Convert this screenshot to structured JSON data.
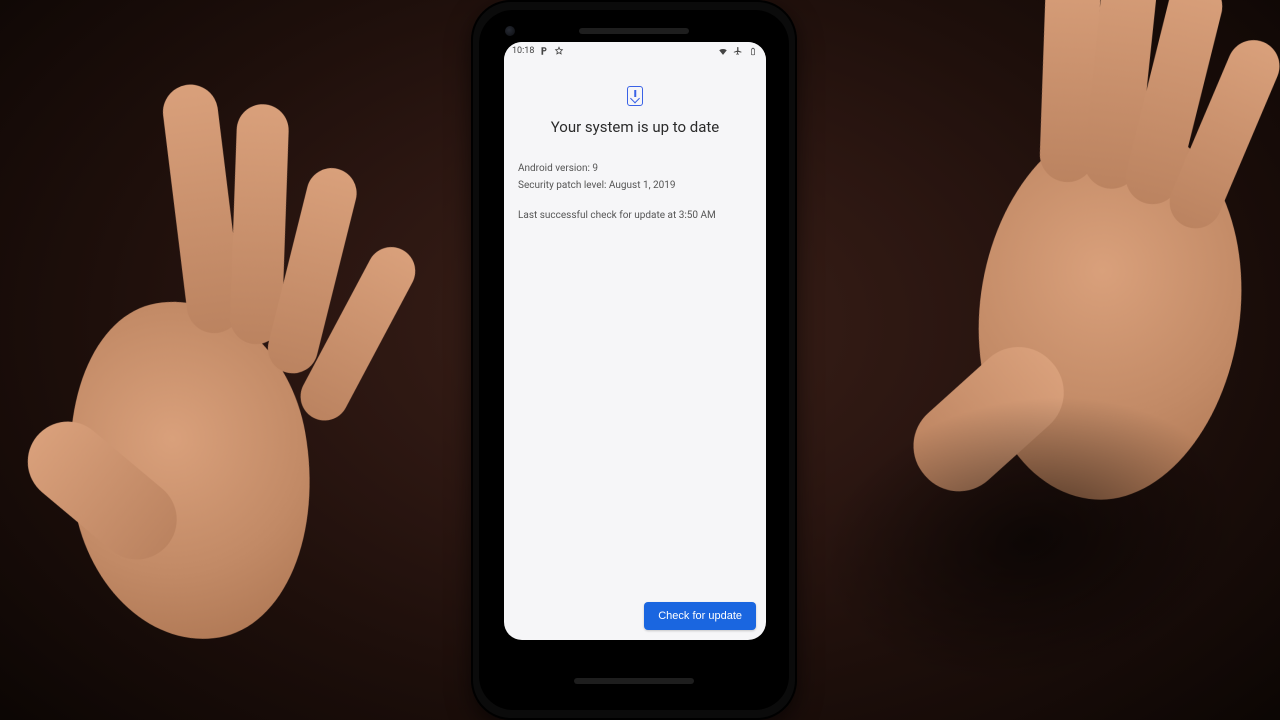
{
  "statusbar": {
    "time": "10:18",
    "left_icons": [
      "parking-icon",
      "star-outline-icon"
    ],
    "right_icons": [
      "wifi-icon",
      "airplane-icon",
      "battery-icon"
    ]
  },
  "header": {
    "icon": "system-update-icon",
    "title": "Your system is up to date"
  },
  "info": {
    "android_version_label": "Android version: 9",
    "security_patch_label": "Security patch level: August 1, 2019",
    "last_check_label": "Last successful check for update at 3:50 AM"
  },
  "actions": {
    "check_update_label": "Check for update"
  },
  "colors": {
    "accent": "#1a66e0",
    "icon_accent": "#3a62e6"
  }
}
